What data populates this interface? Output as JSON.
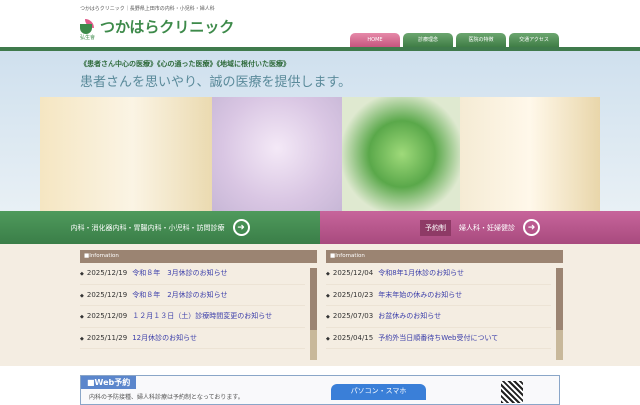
{
  "header": {
    "tagline": "つかはらクリニック｜長野県上田市の内科・小児科・婦人科",
    "logo_text": "つかはらクリニック",
    "logo_sub": "弘生會"
  },
  "nav": [
    {
      "label": "HOME"
    },
    {
      "label": "診療理念"
    },
    {
      "label": "医院の特徴"
    },
    {
      "label": "交通アクセス"
    }
  ],
  "hero": {
    "subtitle": "《患者さん中心の医療》《心の通った医療》《地域に根付いた医療》",
    "title": "患者さんを思いやり、誠の医療を提供します。"
  },
  "departments": {
    "left": "内科・消化器内科・胃腸内科・小児科・訪問診療",
    "right_badge": "予約制",
    "right": "婦人科・妊婦健診"
  },
  "info_left": {
    "heading": "■Infomation",
    "items": [
      {
        "date": "2025/12/19",
        "title": "令和８年　3月休診のお知らせ"
      },
      {
        "date": "2025/12/19",
        "title": "令和８年　2月休診のお知らせ"
      },
      {
        "date": "2025/12/09",
        "title": "１２月１３日（土）診療時間変更のお知らせ"
      },
      {
        "date": "2025/11/29",
        "title": "12月休診のお知らせ"
      }
    ]
  },
  "info_right": {
    "heading": "■Infomation",
    "items": [
      {
        "date": "2025/12/04",
        "title": "令和8年1月休診のお知らせ"
      },
      {
        "date": "2025/10/23",
        "title": "年末年始の休みのお知らせ"
      },
      {
        "date": "2025/07/03",
        "title": "お盆休みのお知らせ"
      },
      {
        "date": "2025/04/15",
        "title": "予約外当日順番待ちWeb受付について"
      }
    ]
  },
  "web": {
    "heading": "■Web予約",
    "text": "内科の予防接種、婦人科診療は予約制となっております。",
    "pc_label": "パソコン・スマホ"
  }
}
